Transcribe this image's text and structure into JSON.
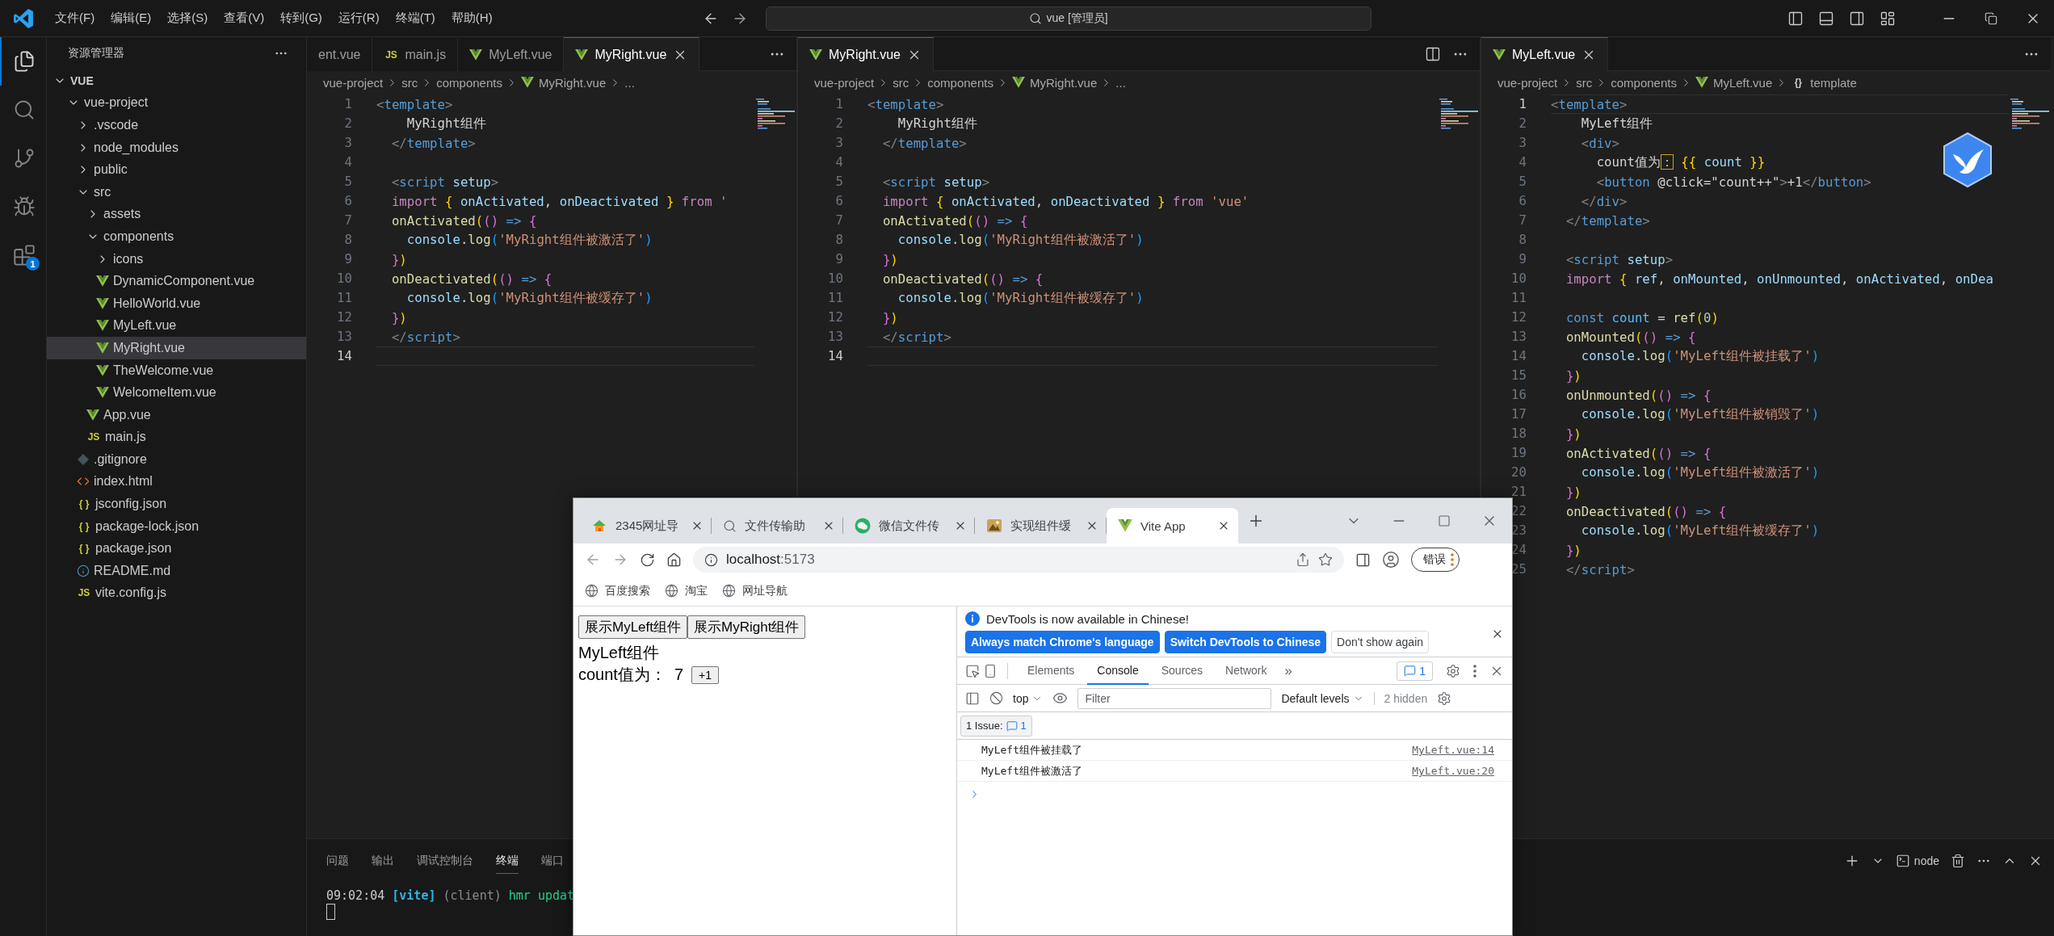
{
  "title_bar": {
    "menus": [
      "文件(F)",
      "编辑(E)",
      "选择(S)",
      "查看(V)",
      "转到(G)",
      "运行(R)",
      "终端(T)",
      "帮助(H)"
    ],
    "search": "vue [管理员]"
  },
  "activity_bar": [
    {
      "kind": "explorer",
      "selected": true
    },
    {
      "kind": "search",
      "selected": false
    },
    {
      "kind": "scm",
      "selected": false
    },
    {
      "kind": "debug",
      "selected": false
    },
    {
      "kind": "extensions",
      "selected": false,
      "badge": "1"
    }
  ],
  "sidebar": {
    "title": "资源管理器",
    "tree": [
      {
        "label": "VUE",
        "kind": "root",
        "expanded": true,
        "selected": false,
        "children": [
          {
            "label": "vue-project",
            "kind": "folder",
            "expanded": true,
            "selected": false,
            "children": [
              {
                "label": ".vscode",
                "kind": "folder",
                "expanded": false,
                "selected": false
              },
              {
                "label": "node_modules",
                "kind": "folder",
                "expanded": false,
                "selected": false
              },
              {
                "label": "public",
                "kind": "folder",
                "expanded": false,
                "selected": false
              },
              {
                "label": "src",
                "kind": "folder",
                "expanded": true,
                "selected": false,
                "children": [
                  {
                    "label": "assets",
                    "kind": "folder",
                    "expanded": false,
                    "selected": false
                  },
                  {
                    "label": "components",
                    "kind": "folder",
                    "expanded": true,
                    "selected": false,
                    "children": [
                      {
                        "label": "icons",
                        "kind": "folder",
                        "expanded": false,
                        "selected": false
                      },
                      {
                        "label": "DynamicComponent.vue",
                        "kind": "vue",
                        "selected": false
                      },
                      {
                        "label": "HelloWorld.vue",
                        "kind": "vue",
                        "selected": false
                      },
                      {
                        "label": "MyLeft.vue",
                        "kind": "vue",
                        "selected": false
                      },
                      {
                        "label": "MyRight.vue",
                        "kind": "vue",
                        "selected": true
                      },
                      {
                        "label": "TheWelcome.vue",
                        "kind": "vue",
                        "selected": false
                      },
                      {
                        "label": "WelcomeItem.vue",
                        "kind": "vue",
                        "selected": false
                      }
                    ]
                  },
                  {
                    "label": "App.vue",
                    "kind": "vue",
                    "selected": false
                  },
                  {
                    "label": "main.js",
                    "kind": "js",
                    "icon_text": "JS",
                    "selected": false
                  }
                ]
              },
              {
                "label": ".gitignore",
                "kind": "git",
                "selected": false
              },
              {
                "label": "index.html",
                "kind": "html",
                "selected": false
              },
              {
                "label": "jsconfig.json",
                "kind": "json",
                "icon_text": "{ }",
                "selected": false
              },
              {
                "label": "package-lock.json",
                "kind": "json",
                "icon_text": "{ }",
                "selected": false
              },
              {
                "label": "package.json",
                "kind": "json",
                "icon_text": "{ }",
                "selected": false
              },
              {
                "label": "README.md",
                "kind": "info",
                "selected": false
              },
              {
                "label": "vite.config.js",
                "kind": "js",
                "icon_text": "JS",
                "selected": false
              }
            ]
          }
        ]
      }
    ]
  },
  "editor_groups": [
    {
      "tabs": [
        {
          "label": "ent.vue",
          "kind": "plain",
          "selected": false
        },
        {
          "label": "main.js",
          "kind": "js",
          "icon_text": "JS",
          "selected": false
        },
        {
          "label": "MyLeft.vue",
          "kind": "vue",
          "selected": false
        },
        {
          "label": "MyRight.vue",
          "kind": "vue",
          "selected": true
        }
      ],
      "actions": [
        {
          "kind": "more"
        }
      ],
      "breadcrumb": [
        {
          "kind": "plain",
          "text": "vue-project"
        },
        {
          "kind": "plain",
          "text": "src"
        },
        {
          "kind": "plain",
          "text": "components"
        },
        {
          "kind": "vue",
          "text": "MyRight.vue"
        },
        {
          "kind": "plain",
          "text": "..."
        }
      ],
      "lines": [
        {
          "n": "1",
          "current": false,
          "tokens": [
            {
              "kind": "p",
              "text": "<"
            },
            {
              "kind": "tag",
              "text": "template"
            },
            {
              "kind": "p",
              "text": ">"
            }
          ]
        },
        {
          "n": "2",
          "current": false,
          "tokens": [
            {
              "kind": "txt",
              "text": "    MyRight组件"
            }
          ]
        },
        {
          "n": "3",
          "current": false,
          "tokens": [
            {
              "kind": "p",
              "text": "  </"
            },
            {
              "kind": "tag",
              "text": "template"
            },
            {
              "kind": "p",
              "text": ">"
            }
          ]
        },
        {
          "n": "4",
          "current": false
        },
        {
          "n": "5",
          "current": false,
          "tokens": [
            {
              "kind": "p",
              "text": "  <"
            },
            {
              "kind": "tag",
              "text": "script "
            },
            {
              "kind": "var",
              "text": "setup"
            },
            {
              "kind": "p",
              "text": ">"
            }
          ]
        },
        {
          "n": "6",
          "current": false,
          "tokens": [
            {
              "kind": "kw",
              "text": "  import "
            },
            {
              "kind": "b1",
              "text": "{ "
            },
            {
              "kind": "var",
              "text": "onActivated"
            },
            {
              "kind": "txt",
              "text": ", "
            },
            {
              "kind": "var",
              "text": "onDeactivated "
            },
            {
              "kind": "b1",
              "text": "} "
            },
            {
              "kind": "kw",
              "text": "from "
            },
            {
              "kind": "str",
              "text": "'"
            }
          ]
        },
        {
          "n": "7",
          "current": false,
          "tokens": [
            {
              "kind": "fn",
              "text": "  onActivated"
            },
            {
              "kind": "b1",
              "text": "("
            },
            {
              "kind": "b2",
              "text": "()"
            },
            {
              "kind": "st",
              "text": " => "
            },
            {
              "kind": "b2",
              "text": "{"
            }
          ]
        },
        {
          "n": "8",
          "current": false,
          "tokens": [
            {
              "kind": "var",
              "text": "    console"
            },
            {
              "kind": "txt",
              "text": "."
            },
            {
              "kind": "fn",
              "text": "log"
            },
            {
              "kind": "b3",
              "text": "("
            },
            {
              "kind": "str",
              "text": "'MyRight组件被激活了'"
            },
            {
              "kind": "b3",
              "text": ")"
            }
          ]
        },
        {
          "n": "9",
          "current": false,
          "tokens": [
            {
              "kind": "b2",
              "text": "  }"
            },
            {
              "kind": "b1",
              "text": ")"
            }
          ]
        },
        {
          "n": "10",
          "current": false,
          "tokens": [
            {
              "kind": "fn",
              "text": "  onDeactivated"
            },
            {
              "kind": "b1",
              "text": "("
            },
            {
              "kind": "b2",
              "text": "()"
            },
            {
              "kind": "st",
              "text": " => "
            },
            {
              "kind": "b2",
              "text": "{"
            }
          ]
        },
        {
          "n": "11",
          "current": false,
          "tokens": [
            {
              "kind": "var",
              "text": "    console"
            },
            {
              "kind": "txt",
              "text": "."
            },
            {
              "kind": "fn",
              "text": "log"
            },
            {
              "kind": "b3",
              "text": "("
            },
            {
              "kind": "str",
              "text": "'MyRight组件被缓存了'"
            },
            {
              "kind": "b3",
              "text": ")"
            }
          ]
        },
        {
          "n": "12",
          "current": false,
          "tokens": [
            {
              "kind": "b2",
              "text": "  }"
            },
            {
              "kind": "b1",
              "text": ")"
            }
          ]
        },
        {
          "n": "13",
          "current": false,
          "tokens": [
            {
              "kind": "p",
              "text": "  </"
            },
            {
              "kind": "tag",
              "text": "script"
            },
            {
              "kind": "p",
              "text": ">"
            }
          ]
        },
        {
          "n": "14",
          "current": true
        }
      ]
    },
    {
      "tabs": [
        {
          "label": "MyRight.vue",
          "kind": "vue",
          "selected": true
        }
      ],
      "actions": [
        {
          "kind": "split"
        },
        {
          "kind": "more"
        }
      ],
      "breadcrumb": [
        {
          "kind": "plain",
          "text": "vue-project"
        },
        {
          "kind": "plain",
          "text": "src"
        },
        {
          "kind": "plain",
          "text": "components"
        },
        {
          "kind": "vue",
          "text": "MyRight.vue"
        },
        {
          "kind": "plain",
          "text": "..."
        }
      ],
      "lines": [
        {
          "n": "1",
          "current": false,
          "tokens": [
            {
              "kind": "p",
              "text": "<"
            },
            {
              "kind": "tag",
              "text": "template"
            },
            {
              "kind": "p",
              "text": ">"
            }
          ]
        },
        {
          "n": "2",
          "current": false,
          "tokens": [
            {
              "kind": "txt",
              "text": "    MyRight组件"
            }
          ]
        },
        {
          "n": "3",
          "current": false,
          "tokens": [
            {
              "kind": "p",
              "text": "  </"
            },
            {
              "kind": "tag",
              "text": "template"
            },
            {
              "kind": "p",
              "text": ">"
            }
          ]
        },
        {
          "n": "4",
          "current": false
        },
        {
          "n": "5",
          "current": false,
          "tokens": [
            {
              "kind": "p",
              "text": "  <"
            },
            {
              "kind": "tag",
              "text": "script "
            },
            {
              "kind": "var",
              "text": "setup"
            },
            {
              "kind": "p",
              "text": ">"
            }
          ]
        },
        {
          "n": "6",
          "current": false,
          "tokens": [
            {
              "kind": "kw",
              "text": "  import "
            },
            {
              "kind": "b1",
              "text": "{ "
            },
            {
              "kind": "var",
              "text": "onActivated"
            },
            {
              "kind": "txt",
              "text": ", "
            },
            {
              "kind": "var",
              "text": "onDeactivated "
            },
            {
              "kind": "b1",
              "text": "} "
            },
            {
              "kind": "kw",
              "text": "from "
            },
            {
              "kind": "str",
              "text": "'vue'"
            }
          ]
        },
        {
          "n": "7",
          "current": false,
          "tokens": [
            {
              "kind": "fn",
              "text": "  onActivated"
            },
            {
              "kind": "b1",
              "text": "("
            },
            {
              "kind": "b2",
              "text": "()"
            },
            {
              "kind": "st",
              "text": " => "
            },
            {
              "kind": "b2",
              "text": "{"
            }
          ]
        },
        {
          "n": "8",
          "current": false,
          "tokens": [
            {
              "kind": "var",
              "text": "    console"
            },
            {
              "kind": "txt",
              "text": "."
            },
            {
              "kind": "fn",
              "text": "log"
            },
            {
              "kind": "b3",
              "text": "("
            },
            {
              "kind": "str",
              "text": "'MyRight组件被激活了'"
            },
            {
              "kind": "b3",
              "text": ")"
            }
          ]
        },
        {
          "n": "9",
          "current": false,
          "tokens": [
            {
              "kind": "b2",
              "text": "  }"
            },
            {
              "kind": "b1",
              "text": ")"
            }
          ]
        },
        {
          "n": "10",
          "current": false,
          "tokens": [
            {
              "kind": "fn",
              "text": "  onDeactivated"
            },
            {
              "kind": "b1",
              "text": "("
            },
            {
              "kind": "b2",
              "text": "()"
            },
            {
              "kind": "st",
              "text": " => "
            },
            {
              "kind": "b2",
              "text": "{"
            }
          ]
        },
        {
          "n": "11",
          "current": false,
          "tokens": [
            {
              "kind": "var",
              "text": "    console"
            },
            {
              "kind": "txt",
              "text": "."
            },
            {
              "kind": "fn",
              "text": "log"
            },
            {
              "kind": "b3",
              "text": "("
            },
            {
              "kind": "str",
              "text": "'MyRight组件被缓存了'"
            },
            {
              "kind": "b3",
              "text": ")"
            }
          ]
        },
        {
          "n": "12",
          "current": false,
          "tokens": [
            {
              "kind": "b2",
              "text": "  }"
            },
            {
              "kind": "b1",
              "text": ")"
            }
          ]
        },
        {
          "n": "13",
          "current": false,
          "tokens": [
            {
              "kind": "p",
              "text": "  </"
            },
            {
              "kind": "tag",
              "text": "script"
            },
            {
              "kind": "p",
              "text": ">"
            }
          ]
        },
        {
          "n": "14",
          "current": true
        }
      ]
    },
    {
      "tabs": [
        {
          "label": "MyLeft.vue",
          "kind": "vue",
          "selected": true
        }
      ],
      "actions": [
        {
          "kind": "more"
        }
      ],
      "breadcrumb": [
        {
          "kind": "plain",
          "text": "vue-project"
        },
        {
          "kind": "plain",
          "text": "src"
        },
        {
          "kind": "plain",
          "text": "components"
        },
        {
          "kind": "vue",
          "text": "MyLeft.vue"
        },
        {
          "kind": "symbol",
          "icon_text": "{}",
          "text": "template"
        }
      ],
      "lines": [
        {
          "n": "1",
          "current": true,
          "tokens": [
            {
              "kind": "p",
              "text": "<"
            },
            {
              "kind": "tag",
              "text": "template"
            },
            {
              "kind": "p",
              "text": ">"
            }
          ]
        },
        {
          "n": "2",
          "current": false,
          "tokens": [
            {
              "kind": "txt",
              "text": "    MyLeft组件"
            }
          ]
        },
        {
          "n": "3",
          "current": false,
          "tokens": [
            {
              "kind": "p",
              "text": "    <"
            },
            {
              "kind": "tag",
              "text": "div"
            },
            {
              "kind": "p",
              "text": ">"
            }
          ]
        },
        {
          "n": "4",
          "current": false,
          "tokens": [
            {
              "kind": "txt",
              "text": "      count值为"
            },
            {
              "kind": "mark",
              "text": "："
            },
            {
              "kind": "b1",
              "text": " {{ "
            },
            {
              "kind": "var",
              "text": "count"
            },
            {
              "kind": "b1",
              "text": " }}"
            }
          ]
        },
        {
          "n": "5",
          "current": false,
          "tokens": [
            {
              "kind": "p",
              "text": "      <"
            },
            {
              "kind": "tag",
              "text": "button "
            },
            {
              "kind": "txt",
              "text": "@click=\"count++\""
            },
            {
              "kind": "p",
              "text": ">"
            },
            {
              "kind": "txt",
              "text": "+1"
            },
            {
              "kind": "p",
              "text": "</"
            },
            {
              "kind": "tag",
              "text": "button"
            },
            {
              "kind": "p",
              "text": ">"
            }
          ]
        },
        {
          "n": "6",
          "current": false,
          "tokens": [
            {
              "kind": "p",
              "text": "    </"
            },
            {
              "kind": "tag",
              "text": "div"
            },
            {
              "kind": "p",
              "text": ">"
            }
          ]
        },
        {
          "n": "7",
          "current": false,
          "tokens": [
            {
              "kind": "p",
              "text": "  </"
            },
            {
              "kind": "tag",
              "text": "template"
            },
            {
              "kind": "p",
              "text": ">"
            }
          ]
        },
        {
          "n": "8",
          "current": false
        },
        {
          "n": "9",
          "current": false,
          "tokens": [
            {
              "kind": "p",
              "text": "  <"
            },
            {
              "kind": "tag",
              "text": "script "
            },
            {
              "kind": "var",
              "text": "setup"
            },
            {
              "kind": "p",
              "text": ">"
            }
          ]
        },
        {
          "n": "10",
          "current": false,
          "tokens": [
            {
              "kind": "kw",
              "text": "  import "
            },
            {
              "kind": "b1",
              "text": "{ "
            },
            {
              "kind": "var",
              "text": "ref"
            },
            {
              "kind": "txt",
              "text": ", "
            },
            {
              "kind": "var",
              "text": "onMounted"
            },
            {
              "kind": "txt",
              "text": ", "
            },
            {
              "kind": "var",
              "text": "onUnmounted"
            },
            {
              "kind": "txt",
              "text": ", "
            },
            {
              "kind": "var",
              "text": "onActivated"
            },
            {
              "kind": "txt",
              "text": ", "
            },
            {
              "kind": "var",
              "text": "onDea"
            }
          ]
        },
        {
          "n": "11",
          "current": false
        },
        {
          "n": "12",
          "current": false,
          "tokens": [
            {
              "kind": "st",
              "text": "  const "
            },
            {
              "kind": "const",
              "text": "count"
            },
            {
              "kind": "txt",
              "text": " = "
            },
            {
              "kind": "fn",
              "text": "ref"
            },
            {
              "kind": "b1",
              "text": "("
            },
            {
              "kind": "num",
              "text": "0"
            },
            {
              "kind": "b1",
              "text": ")"
            }
          ]
        },
        {
          "n": "13",
          "current": false,
          "tokens": [
            {
              "kind": "fn",
              "text": "  onMounted"
            },
            {
              "kind": "b1",
              "text": "("
            },
            {
              "kind": "b2",
              "text": "()"
            },
            {
              "kind": "st",
              "text": " => "
            },
            {
              "kind": "b2",
              "text": "{"
            }
          ]
        },
        {
          "n": "14",
          "current": false,
          "tokens": [
            {
              "kind": "var",
              "text": "    console"
            },
            {
              "kind": "txt",
              "text": "."
            },
            {
              "kind": "fn",
              "text": "log"
            },
            {
              "kind": "b3",
              "text": "("
            },
            {
              "kind": "str",
              "text": "'MyLeft组件被挂载了'"
            },
            {
              "kind": "b3",
              "text": ")"
            }
          ]
        },
        {
          "n": "15",
          "current": false,
          "tokens": [
            {
              "kind": "b2",
              "text": "  }"
            },
            {
              "kind": "b1",
              "text": ")"
            }
          ]
        },
        {
          "n": "16",
          "current": false,
          "tokens": [
            {
              "kind": "fn",
              "text": "  onUnmounted"
            },
            {
              "kind": "b1",
              "text": "("
            },
            {
              "kind": "b2",
              "text": "()"
            },
            {
              "kind": "st",
              "text": " => "
            },
            {
              "kind": "b2",
              "text": "{"
            }
          ]
        },
        {
          "n": "17",
          "current": false,
          "tokens": [
            {
              "kind": "var",
              "text": "    console"
            },
            {
              "kind": "txt",
              "text": "."
            },
            {
              "kind": "fn",
              "text": "log"
            },
            {
              "kind": "b3",
              "text": "("
            },
            {
              "kind": "str",
              "text": "'MyLeft组件被销毁了'"
            },
            {
              "kind": "b3",
              "text": ")"
            }
          ]
        },
        {
          "n": "18",
          "current": false,
          "tokens": [
            {
              "kind": "b2",
              "text": "  }"
            },
            {
              "kind": "b1",
              "text": ")"
            }
          ]
        },
        {
          "n": "19",
          "current": false,
          "tokens": [
            {
              "kind": "fn",
              "text": "  onActivated"
            },
            {
              "kind": "b1",
              "text": "("
            },
            {
              "kind": "b2",
              "text": "()"
            },
            {
              "kind": "st",
              "text": " => "
            },
            {
              "kind": "b2",
              "text": "{"
            }
          ]
        },
        {
          "n": "20",
          "current": false,
          "tokens": [
            {
              "kind": "var",
              "text": "    console"
            },
            {
              "kind": "txt",
              "text": "."
            },
            {
              "kind": "fn",
              "text": "log"
            },
            {
              "kind": "b3",
              "text": "("
            },
            {
              "kind": "str",
              "text": "'MyLeft组件被激活了'"
            },
            {
              "kind": "b3",
              "text": ")"
            }
          ]
        },
        {
          "n": "21",
          "current": false,
          "tokens": [
            {
              "kind": "b2",
              "text": "  }"
            },
            {
              "kind": "b1",
              "text": ")"
            }
          ]
        },
        {
          "n": "22",
          "current": false,
          "tokens": [
            {
              "kind": "fn",
              "text": "  onDeactivated"
            },
            {
              "kind": "b1",
              "text": "("
            },
            {
              "kind": "b2",
              "text": "()"
            },
            {
              "kind": "st",
              "text": " => "
            },
            {
              "kind": "b2",
              "text": "{"
            }
          ]
        },
        {
          "n": "23",
          "current": false,
          "tokens": [
            {
              "kind": "var",
              "text": "    console"
            },
            {
              "kind": "txt",
              "text": "."
            },
            {
              "kind": "fn",
              "text": "log"
            },
            {
              "kind": "b3",
              "text": "("
            },
            {
              "kind": "str",
              "text": "'MyLeft组件被缓存了'"
            },
            {
              "kind": "b3",
              "text": ")"
            }
          ]
        },
        {
          "n": "24",
          "current": false,
          "tokens": [
            {
              "kind": "b2",
              "text": "  }"
            },
            {
              "kind": "b1",
              "text": ")"
            }
          ]
        },
        {
          "n": "25",
          "current": false,
          "tokens": [
            {
              "kind": "p",
              "text": "  </"
            },
            {
              "kind": "tag",
              "text": "script"
            },
            {
              "kind": "p",
              "text": ">"
            }
          ]
        }
      ]
    }
  ],
  "panel": {
    "tabs": [
      {
        "label": "问题",
        "selected": false
      },
      {
        "label": "输出",
        "selected": false
      },
      {
        "label": "调试控制台",
        "selected": false
      },
      {
        "label": "终端",
        "selected": true
      },
      {
        "label": "端口",
        "selected": false
      }
    ],
    "terminal": [
      {
        "kind": "time",
        "text": "09:02:04"
      },
      {
        "kind": "tag",
        "text": "[vite]"
      },
      {
        "kind": "dim",
        "text": "(client)"
      },
      {
        "kind": "ok",
        "text": "hmr updat"
      }
    ],
    "shell": "node"
  },
  "browser": {
    "tabs": [
      {
        "label": "2345网址导",
        "kind": "home",
        "selected": false
      },
      {
        "label": "文件传输助",
        "kind": "search",
        "selected": false
      },
      {
        "label": "微信文件传",
        "kind": "chat",
        "selected": false
      },
      {
        "label": "实现组件缓",
        "kind": "image",
        "selected": false
      },
      {
        "label": "Vite App",
        "kind": "vue",
        "selected": true
      }
    ],
    "address": {
      "host": "localhost",
      "port": ":5173"
    },
    "profile_button": "错误",
    "bookmarks": [
      "百度搜索",
      "淘宝",
      "网址导航"
    ],
    "page": {
      "buttons": [
        "展示MyLeft组件",
        "展示MyRight组件"
      ],
      "heading": "MyLeft组件",
      "count_label": "count值为：",
      "count": "7",
      "increment": "+1"
    },
    "devtools": {
      "banner": {
        "message": "DevTools is now available in Chinese!",
        "buttons": [
          {
            "label": "Always match Chrome's language",
            "kind": "primary"
          },
          {
            "label": "Switch DevTools to Chinese",
            "kind": "primary"
          },
          {
            "label": "Don't show again",
            "kind": "secondary"
          }
        ]
      },
      "tabs": [
        {
          "label": "Elements",
          "selected": false
        },
        {
          "label": "Console",
          "selected": true
        },
        {
          "label": "Sources",
          "selected": false
        },
        {
          "label": "Network",
          "selected": false
        }
      ],
      "more_tabs": "»",
      "issues_badge": "1",
      "context": "top",
      "filter_placeholder": "Filter",
      "levels": "Default levels",
      "hidden": "2 hidden",
      "issues": {
        "label": "1 Issue:",
        "count": "1"
      },
      "messages": [
        {
          "text": "MyLeft组件被挂载了",
          "source": "MyLeft.vue:14"
        },
        {
          "text": "MyLeft组件被激活了",
          "source": "MyLeft.vue:20"
        }
      ]
    }
  }
}
